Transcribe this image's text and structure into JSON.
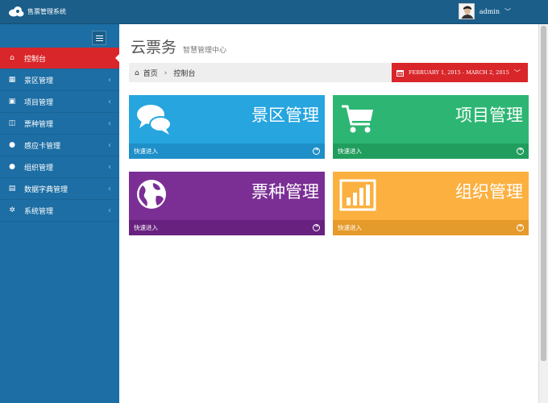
{
  "header": {
    "app_name": "售票管理系统",
    "username": "admin",
    "caret": "﹀"
  },
  "sidebar": {
    "items": [
      {
        "label": "控制台",
        "icon": "home-icon",
        "glyph": "⌂",
        "active": true
      },
      {
        "label": "景区管理",
        "icon": "grid-icon",
        "glyph": "▦",
        "arrow": "‹"
      },
      {
        "label": "项目管理",
        "icon": "briefcase-icon",
        "glyph": "▣",
        "arrow": "‹"
      },
      {
        "label": "票种管理",
        "icon": "ticket-icon",
        "glyph": "◫",
        "arrow": "‹"
      },
      {
        "label": "感应卡管理",
        "icon": "user-icon",
        "glyph": "●",
        "arrow": "‹"
      },
      {
        "label": "组织管理",
        "icon": "user-icon",
        "glyph": "●",
        "arrow": "‹"
      },
      {
        "label": "数据字典管理",
        "icon": "table-icon",
        "glyph": "▤",
        "arrow": "‹"
      },
      {
        "label": "系统管理",
        "icon": "gears-icon",
        "glyph": "✲",
        "arrow": "‹"
      }
    ]
  },
  "page": {
    "title": "云票务",
    "subtitle": "智慧管理中心"
  },
  "breadcrumb": {
    "home_glyph": "⌂",
    "home": "首页",
    "sep": "›",
    "current": "控制台"
  },
  "date_range": {
    "label": "FEBRUARY 1, 2015 - MARCH 2, 2015",
    "caret": "﹀"
  },
  "tiles": [
    {
      "title": "景区管理",
      "footer": "快速进入",
      "icon": "comments-icon"
    },
    {
      "title": "项目管理",
      "footer": "快速进入",
      "icon": "shopping-cart-icon"
    },
    {
      "title": "票种管理",
      "footer": "快速进入",
      "icon": "globe-icon"
    },
    {
      "title": "组织管理",
      "footer": "快速进入",
      "icon": "bar-chart-icon"
    }
  ],
  "colors": {
    "topbar": "#1b5e8a",
    "sidebar": "#1c6ea4",
    "active": "#d9262a",
    "tile_blue": "#26a5df",
    "tile_green": "#2db673",
    "tile_purple": "#7b2f95",
    "tile_orange": "#fbb040"
  }
}
